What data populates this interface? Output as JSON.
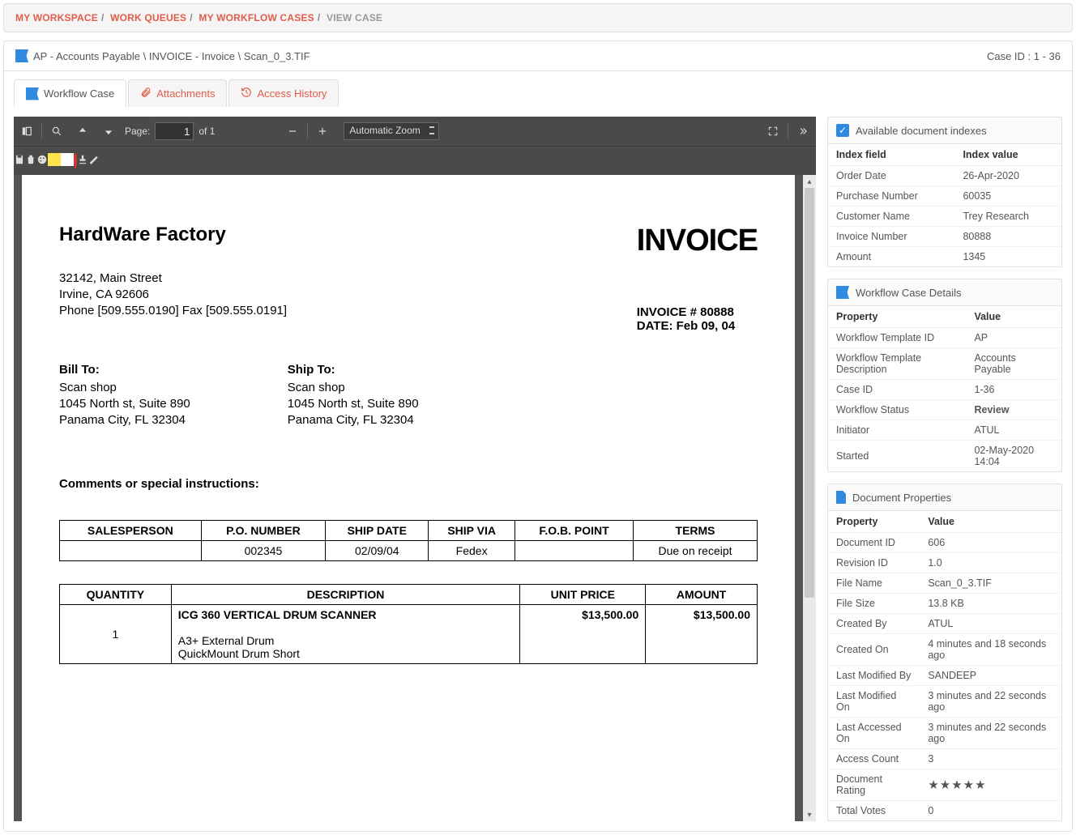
{
  "breadcrumb": {
    "a": "MY WORKSPACE",
    "b": "WORK QUEUES",
    "c": "MY WORKFLOW CASES",
    "d": "VIEW CASE"
  },
  "header": {
    "path": "AP - Accounts Payable \\ INVOICE - Invoice \\ Scan_0_3.TIF",
    "caseid": "Case ID : 1 - 36"
  },
  "tabs": {
    "wf": "Workflow Case",
    "att": "Attachments",
    "hist": "Access History"
  },
  "viewer": {
    "page_label": "Page:",
    "page_value": "1",
    "page_of": "of 1",
    "zoom": "Automatic Zoom"
  },
  "indexes": {
    "title": "Available document indexes",
    "h1": "Index field",
    "h2": "Index value",
    "rows": [
      [
        "Order Date",
        "26-Apr-2020"
      ],
      [
        "Purchase Number",
        "60035"
      ],
      [
        "Customer Name",
        "Trey Research"
      ],
      [
        "Invoice Number",
        "80888"
      ],
      [
        "Amount",
        "1345"
      ]
    ]
  },
  "wfdetails": {
    "title": "Workflow Case Details",
    "h1": "Property",
    "h2": "Value",
    "rows": [
      [
        "Workflow Template ID",
        "AP"
      ],
      [
        "Workflow Template Description",
        "Accounts Payable"
      ],
      [
        "Case ID",
        "1-36"
      ],
      [
        "Workflow Status",
        "Review"
      ],
      [
        "Initiator",
        "ATUL"
      ],
      [
        "Started",
        "02-May-2020 14:04"
      ]
    ]
  },
  "docprops": {
    "title": "Document Properties",
    "h1": "Property",
    "h2": "Value",
    "rows": [
      [
        "Document ID",
        "606"
      ],
      [
        "Revision ID",
        "1.0"
      ],
      [
        "File Name",
        "Scan_0_3.TIF"
      ],
      [
        "File Size",
        "13.8 KB"
      ],
      [
        "Created By",
        "ATUL"
      ],
      [
        "Created On",
        "4 minutes and 18 seconds ago"
      ],
      [
        "Last Modified By",
        "SANDEEP"
      ],
      [
        "Last Modified On",
        "3 minutes and 22 seconds ago"
      ],
      [
        "Last Accessed On",
        "3 minutes and 22 seconds ago"
      ],
      [
        "Access Count",
        "3"
      ],
      [
        "Document Rating",
        "★★★★★"
      ],
      [
        "Total Votes",
        "0"
      ]
    ]
  },
  "invoice": {
    "company": "HardWare Factory",
    "addr1": "32142, Main Street",
    "addr2": "Irvine, CA 92606",
    "addr3": "Phone [509.555.0190]  Fax [509.555.0191]",
    "h": "INVOICE",
    "num": "INVOICE # 80888",
    "date": "DATE: Feb 09, 04",
    "billto_h": "Bill To:",
    "shipto_h": "Ship To:",
    "b1": "Scan shop",
    "b2": "1045 North st, Suite 890",
    "b3": "Panama City, FL 32304",
    "comments": "Comments or special instructions:",
    "t1h": [
      "SALESPERSON",
      "P.O. NUMBER",
      "SHIP DATE",
      "SHIP VIA",
      "F.O.B. POINT",
      "TERMS"
    ],
    "t1r": [
      "",
      "002345",
      "02/09/04",
      "Fedex",
      "",
      "Due on receipt"
    ],
    "t2h": [
      "QUANTITY",
      "DESCRIPTION",
      "UNIT PRICE",
      "AMOUNT"
    ],
    "t2r": {
      "qty": "1",
      "desc1": "ICG 360 VERTICAL DRUM SCANNER",
      "desc2": "A3+ External Drum",
      "desc3": "QuickMount Drum Short",
      "unit": "$13,500.00",
      "amt": "$13,500.00"
    }
  }
}
